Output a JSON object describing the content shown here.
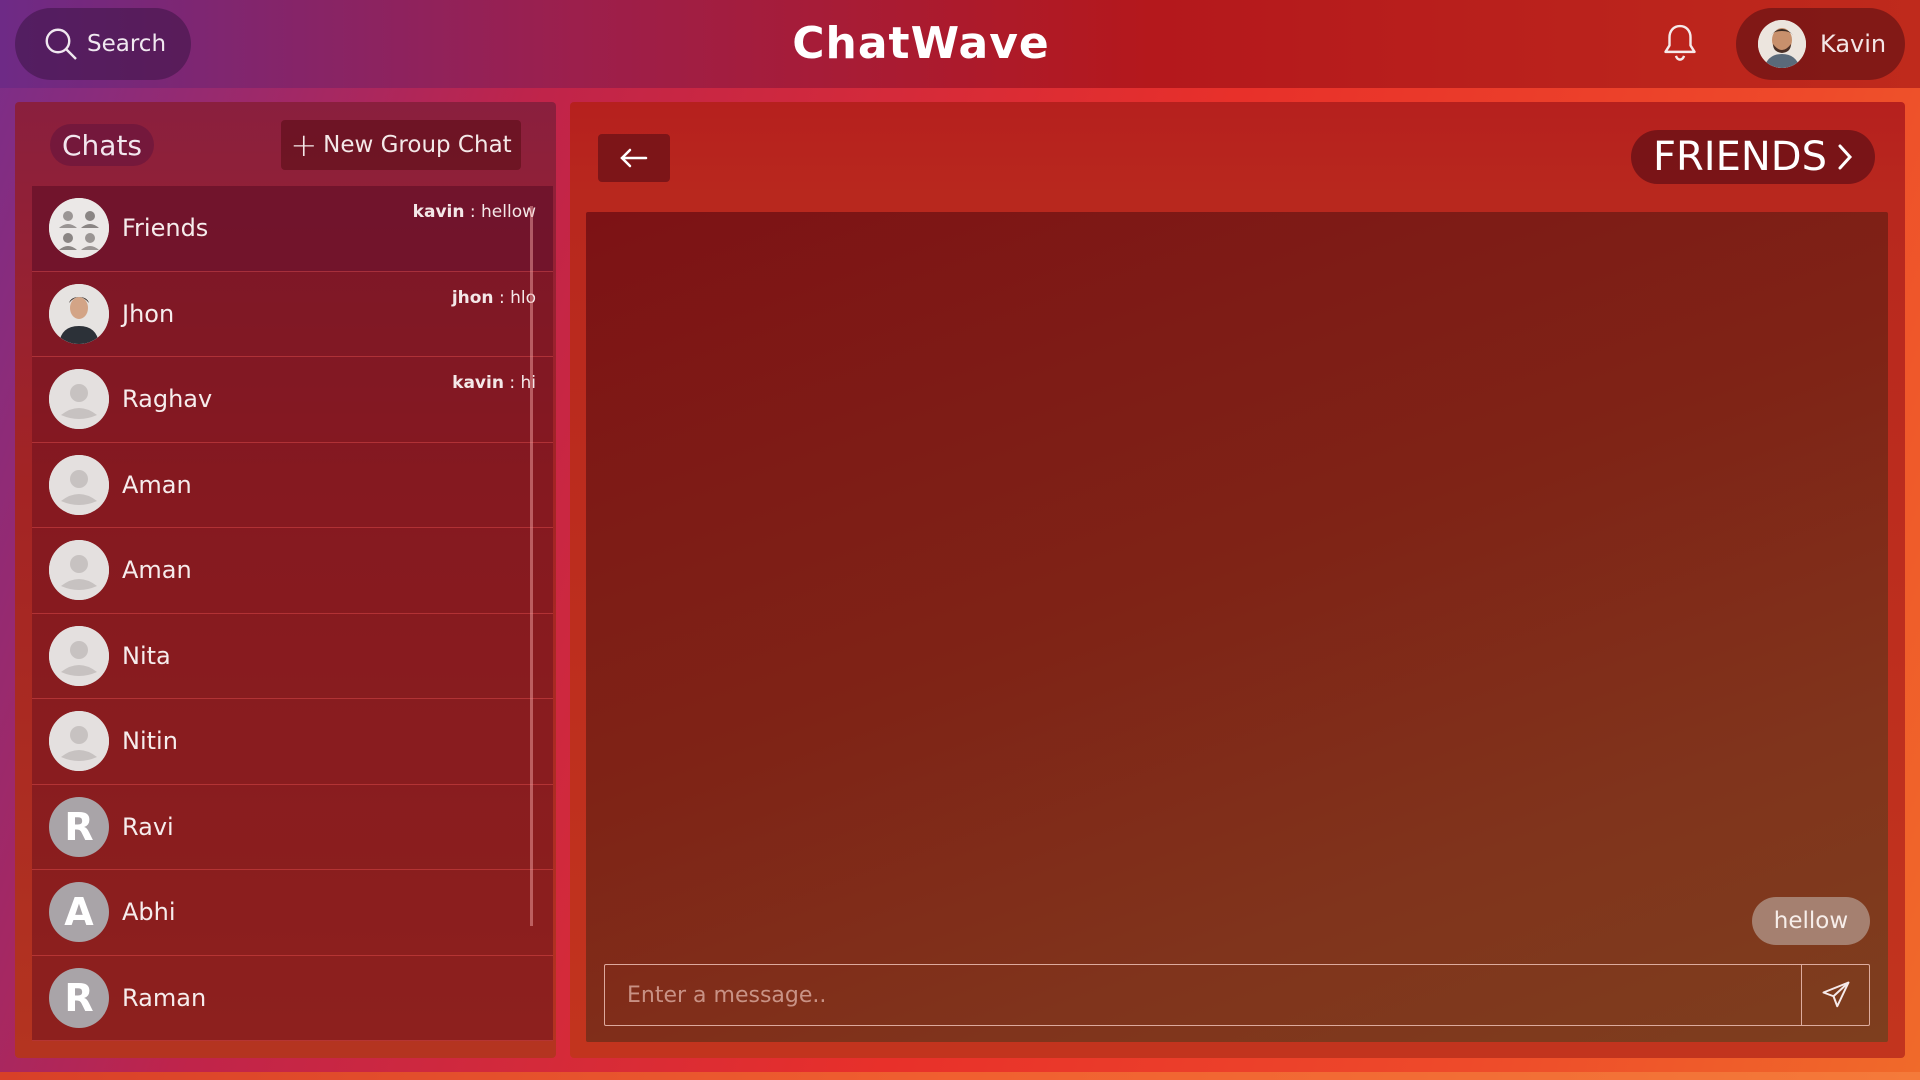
{
  "topbar": {
    "search_label": "Search",
    "app_title": "ChatWave",
    "user_name": "Kavin"
  },
  "sidebar": {
    "title": "Chats",
    "new_group_label": "New Group Chat",
    "items": [
      {
        "name": "Friends",
        "avatar": "group",
        "last_sender": "kavin",
        "last_message": "hellow"
      },
      {
        "name": "Jhon",
        "avatar": "photo",
        "last_sender": "jhon",
        "last_message": "hlo"
      },
      {
        "name": "Raghav",
        "avatar": "default",
        "last_sender": "kavin",
        "last_message": "hi"
      },
      {
        "name": "Aman",
        "avatar": "default",
        "last_sender": "",
        "last_message": ""
      },
      {
        "name": "Aman",
        "avatar": "default",
        "last_sender": "",
        "last_message": ""
      },
      {
        "name": "Nita",
        "avatar": "default",
        "last_sender": "",
        "last_message": ""
      },
      {
        "name": "Nitin",
        "avatar": "default",
        "last_sender": "",
        "last_message": ""
      },
      {
        "name": "Ravi",
        "avatar": "letter",
        "letter": "R",
        "last_sender": "",
        "last_message": ""
      },
      {
        "name": "Abhi",
        "avatar": "letter",
        "letter": "A",
        "last_sender": "",
        "last_message": ""
      },
      {
        "name": "Raman",
        "avatar": "letter",
        "letter": "R",
        "last_sender": "",
        "last_message": ""
      }
    ]
  },
  "chat": {
    "title": "FRIENDS",
    "messages": [
      {
        "text": "hellow",
        "own": true
      }
    ],
    "composer_placeholder": "Enter a message.."
  },
  "colors": {
    "accent": "#b4181c",
    "panel_dark": "#6e1216",
    "bubble": "#a58070"
  }
}
